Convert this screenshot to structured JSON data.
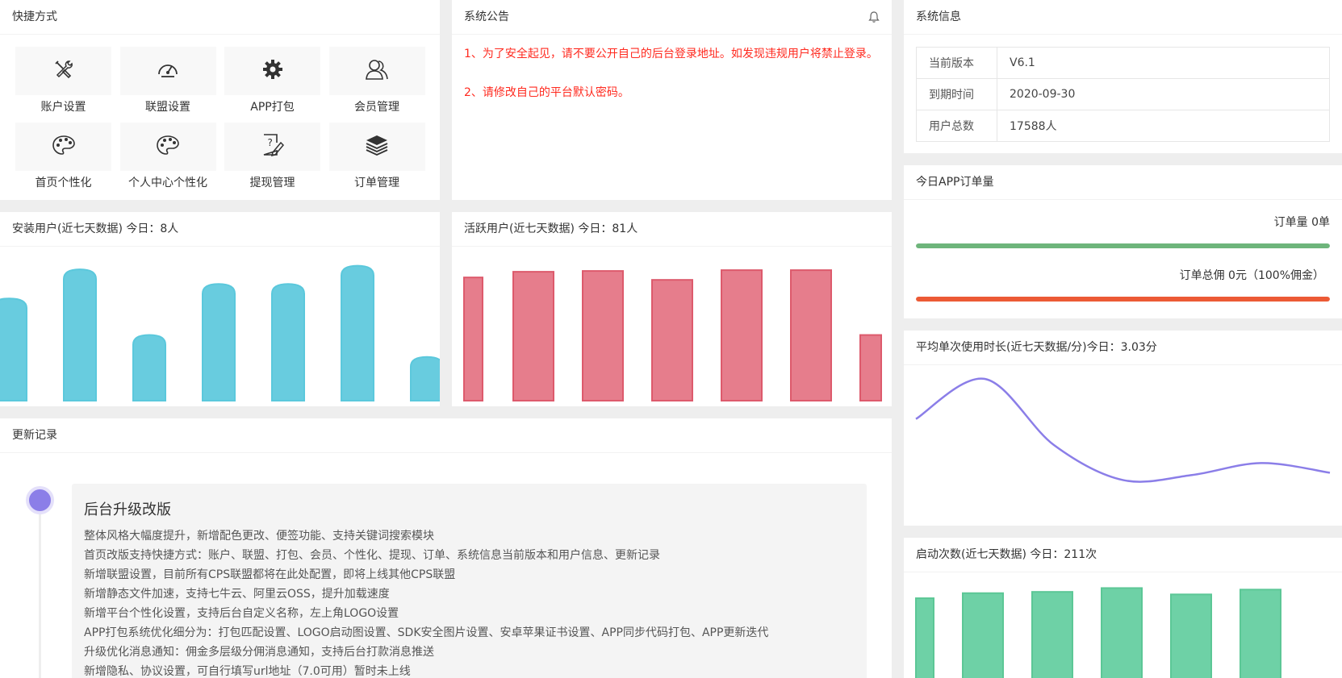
{
  "quick": {
    "title": "快捷方式",
    "items": [
      {
        "label": "账户设置",
        "icon": "tools-icon"
      },
      {
        "label": "联盟设置",
        "icon": "gauge-icon"
      },
      {
        "label": "APP打包",
        "icon": "gear-icon"
      },
      {
        "label": "会员管理",
        "icon": "users-icon"
      },
      {
        "label": "首页个性化",
        "icon": "palette-icon"
      },
      {
        "label": "个人中心个性化",
        "icon": "palette-icon"
      },
      {
        "label": "提现管理",
        "icon": "document-edit-icon"
      },
      {
        "label": "订单管理",
        "icon": "layers-icon"
      }
    ]
  },
  "notice": {
    "title": "系统公告",
    "lines": [
      "1、为了安全起见，请不要公开自己的后台登录地址。如发现违规用户将禁止登录。",
      "2、请修改自己的平台默认密码。"
    ],
    "color": "#ff2a1f"
  },
  "sysinfo": {
    "title": "系统信息",
    "rows": [
      {
        "key": "当前版本",
        "value": "V6.1"
      },
      {
        "key": "到期时间",
        "value": "2020-09-30"
      },
      {
        "key": "用户总数",
        "value": "17588人"
      }
    ]
  },
  "orders": {
    "title": "今日APP订单量",
    "count_label": "订单量 0单",
    "commission_label": "订单总佣 0元（100%佣金）",
    "progress_count": 1.0,
    "progress_commission": 1.0,
    "color_count": "#6eb57b",
    "color_commission": "#ec5a35"
  },
  "install": {
    "title": "安装用户(近七天数据) 今日：8人"
  },
  "active": {
    "title": "活跃用户(近七天数据) 今日：81人"
  },
  "duration": {
    "title": "平均单次使用时长(近七天数据/分)今日：3.03分"
  },
  "launch": {
    "title": "启动次数(近七天数据) 今日：211次"
  },
  "changelog": {
    "title": "更新记录",
    "entry_title": "后台升级改版",
    "items": [
      "整体风格大幅度提升，新增配色更改、便签功能、支持关键词搜索模块",
      "首页改版支持快捷方式：账户、联盟、打包、会员、个性化、提现、订单、系统信息当前版本和用户信息、更新记录",
      "新增联盟设置，目前所有CPS联盟都将在此处配置，即将上线其他CPS联盟",
      "新增静态文件加速，支持七牛云、阿里云OSS，提升加载速度",
      "新增平台个性化设置，支持后台自定义名称，左上角LOGO设置",
      "APP打包系统优化细分为：打包匹配设置、LOGO启动图设置、SDK安全图片设置、安卓苹果证书设置、APP同步代码打包、APP更新迭代",
      "升级优化消息通知：佣金多层级分佣消息通知，支持后台打款消息推送",
      "新增隐私、协议设置，可自行填写url地址（7.0可用）暂时未上线"
    ]
  },
  "chart_data": [
    {
      "type": "bar",
      "title": "安装用户(近七天数据) 今日：8人",
      "values": [
        14,
        18,
        9,
        16,
        16,
        18.5,
        6
      ],
      "ylim": [
        0,
        20
      ],
      "color": "#5bc8dc",
      "grid": false
    },
    {
      "type": "bar",
      "title": "活跃用户(近七天数据) 今日：81人",
      "values": [
        152,
        159,
        160,
        149,
        161,
        161,
        81
      ],
      "ylim": [
        0,
        180
      ],
      "color": "#e57686",
      "grid": false
    },
    {
      "type": "line",
      "title": "平均单次使用时长(近七天数据/分)今日：3.03分",
      "values": [
        8.4,
        12.4,
        5.8,
        2.3,
        2.8,
        4.0,
        3.03
      ],
      "ylim": [
        0,
        12
      ],
      "color": "#8b7ee8",
      "grid": false
    },
    {
      "type": "bar",
      "title": "启动次数(近七天数据) 今日：211次",
      "values": [
        330,
        350,
        355,
        370,
        345,
        364
      ],
      "ylim": [
        0,
        400
      ],
      "color": "#66cfa1",
      "grid": false
    }
  ]
}
